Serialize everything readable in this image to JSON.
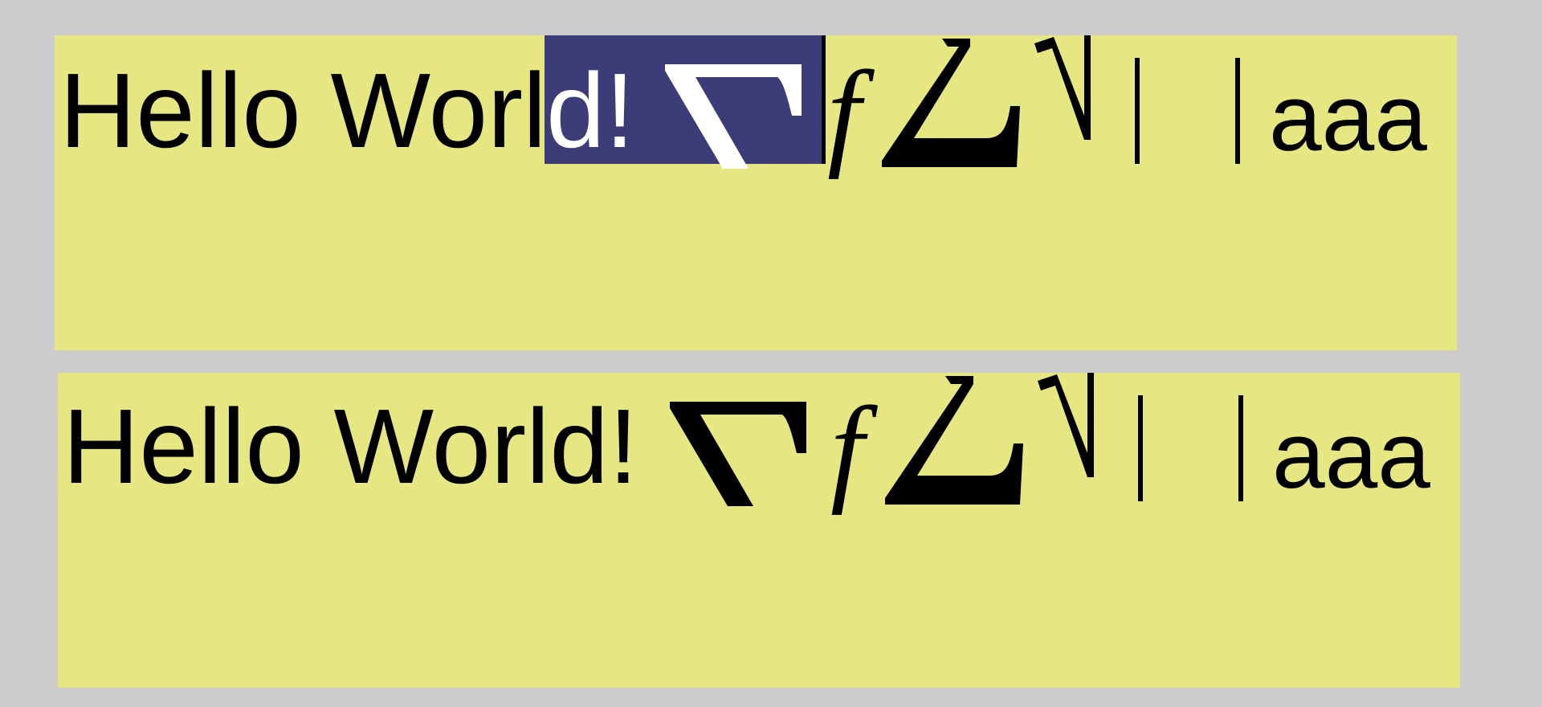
{
  "canvas_background": "#cccccc",
  "box_background": "#e6e682",
  "selection_color": "#3c3c78",
  "top_box": {
    "text_before_selection": "Hello Worl",
    "selected_text": "d!",
    "italic_f": "f",
    "trailing_text": "aaa"
  },
  "bottom_box": {
    "text": "Hello World!",
    "italic_f": "f",
    "trailing_text": "aaa"
  }
}
